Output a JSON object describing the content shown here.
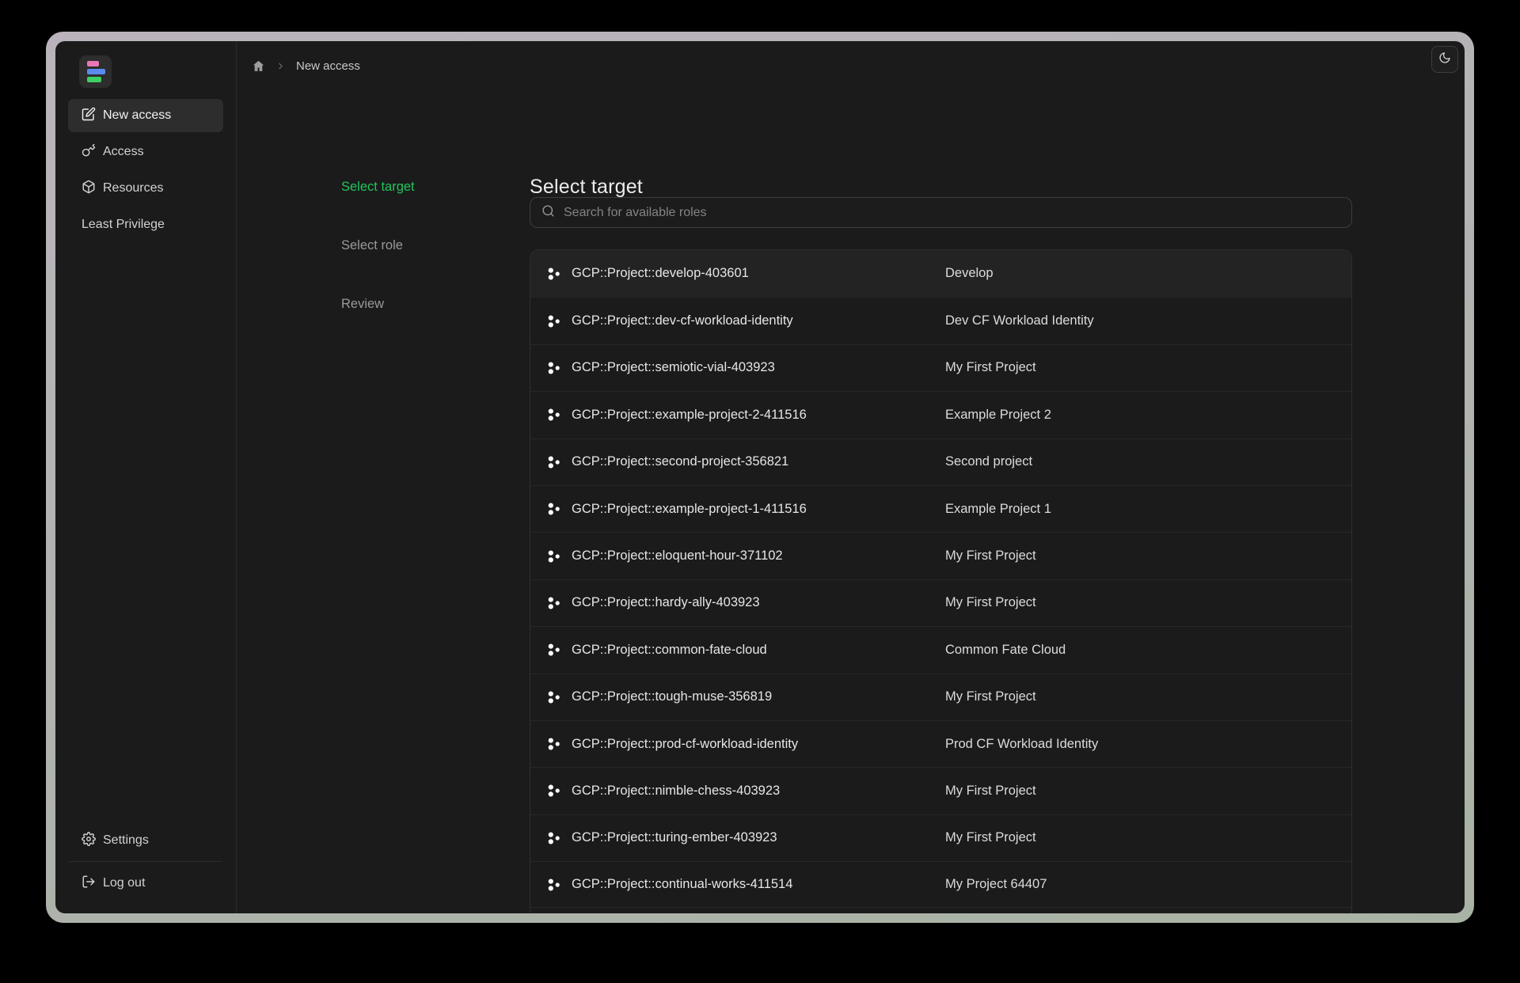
{
  "window": {
    "theme_toggle": {
      "icon": "moon-icon"
    }
  },
  "breadcrumb": {
    "home_icon": "home-icon",
    "separator": "chevron-right-icon",
    "current": "New access"
  },
  "sidebar": {
    "logo": {
      "icon": "common-fate-logo",
      "bar_colors": [
        "#e878b4",
        "#5b8bee",
        "#3ecf63"
      ]
    },
    "nav": [
      {
        "label": "New access",
        "icon": "edit-icon",
        "active": true
      },
      {
        "label": "Access",
        "icon": "key-icon",
        "active": false
      },
      {
        "label": "Resources",
        "icon": "box-icon",
        "active": false
      },
      {
        "label": "Least Privilege",
        "icon": null,
        "active": false
      }
    ],
    "footer": [
      {
        "label": "Settings",
        "icon": "gear-icon"
      },
      {
        "label": "Log out",
        "icon": "logout-icon"
      }
    ]
  },
  "steps": [
    {
      "label": "Select target",
      "active": true
    },
    {
      "label": "Select role",
      "active": false
    },
    {
      "label": "Review",
      "active": false
    }
  ],
  "main": {
    "title": "Select target",
    "search": {
      "placeholder": "Search for available roles",
      "icon": "search-icon",
      "value": ""
    },
    "list": {
      "highlighted_index": 0,
      "row_icon": "gcp-project-icon",
      "rows": [
        {
          "id": "GCP::Project::develop-403601",
          "name": "Develop"
        },
        {
          "id": "GCP::Project::dev-cf-workload-identity",
          "name": "Dev CF Workload Identity"
        },
        {
          "id": "GCP::Project::semiotic-vial-403923",
          "name": "My First Project"
        },
        {
          "id": "GCP::Project::example-project-2-411516",
          "name": "Example Project 2"
        },
        {
          "id": "GCP::Project::second-project-356821",
          "name": "Second project"
        },
        {
          "id": "GCP::Project::example-project-1-411516",
          "name": "Example Project 1"
        },
        {
          "id": "GCP::Project::eloquent-hour-371102",
          "name": "My First Project"
        },
        {
          "id": "GCP::Project::hardy-ally-403923",
          "name": "My First Project"
        },
        {
          "id": "GCP::Project::common-fate-cloud",
          "name": "Common Fate Cloud"
        },
        {
          "id": "GCP::Project::tough-muse-356819",
          "name": "My First Project"
        },
        {
          "id": "GCP::Project::prod-cf-workload-identity",
          "name": "Prod CF Workload Identity"
        },
        {
          "id": "GCP::Project::nimble-chess-403923",
          "name": "My First Project"
        },
        {
          "id": "GCP::Project::turing-ember-403923",
          "name": "My First Project"
        },
        {
          "id": "GCP::Project::continual-works-411514",
          "name": "My Project 64407"
        }
      ]
    }
  },
  "colors": {
    "accent_green": "#22c55e",
    "app_bg": "#1b1b1b",
    "frame_top": "#bab3bd",
    "frame_bottom": "#a9b3a5"
  }
}
